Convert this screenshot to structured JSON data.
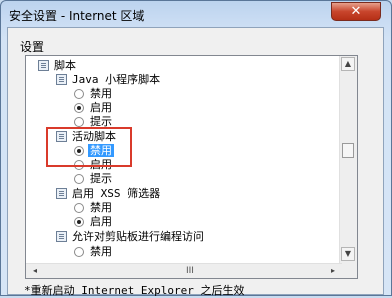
{
  "window": {
    "title": "安全设置 - Internet 区域",
    "close_glyph": "✕"
  },
  "group": {
    "label": "设置"
  },
  "tree": {
    "items": [
      {
        "kind": "category",
        "label": "脚本"
      },
      {
        "kind": "category",
        "label": "Java 小程序脚本"
      },
      {
        "kind": "radio",
        "label": "禁用",
        "checked": false
      },
      {
        "kind": "radio",
        "label": "启用",
        "checked": true
      },
      {
        "kind": "radio",
        "label": "提示",
        "checked": false
      },
      {
        "kind": "category",
        "label": "活动脚本"
      },
      {
        "kind": "radio",
        "label": "禁用",
        "checked": true,
        "selected": true
      },
      {
        "kind": "radio",
        "label": "启用",
        "checked": false
      },
      {
        "kind": "radio",
        "label": "提示",
        "checked": false
      },
      {
        "kind": "category",
        "label": "启用 XSS 筛选器"
      },
      {
        "kind": "radio",
        "label": "禁用",
        "checked": false
      },
      {
        "kind": "radio",
        "label": "启用",
        "checked": true
      },
      {
        "kind": "category",
        "label": "允许对剪贴板进行编程访问"
      },
      {
        "kind": "radio",
        "label": "禁用",
        "checked": false
      }
    ]
  },
  "scrollbar": {
    "up": "▲",
    "down": "▼",
    "left": "◂",
    "right": "▸",
    "grip": "III"
  },
  "footer": {
    "note": "*重新启动 Internet Explorer 之后生效"
  }
}
